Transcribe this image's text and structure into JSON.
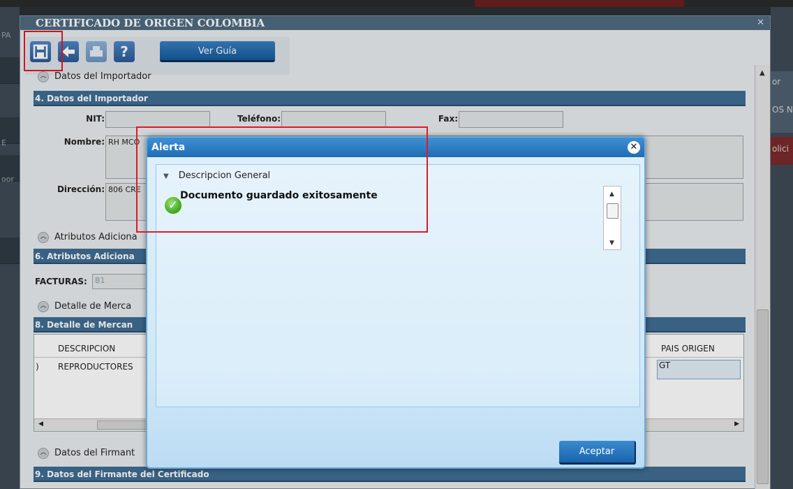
{
  "window": {
    "title": "CERTIFICADO DE ORIGEN COLOMBIA",
    "close_icon": "close-icon"
  },
  "toolbar": {
    "save_icon": "save-icon",
    "back_icon": "back-arrow-icon",
    "print_icon": "print-icon",
    "help_label": "?",
    "guide_label": "Ver Guía"
  },
  "sections": {
    "importer_toggle": "Datos del Importador",
    "importer_header": "4. Datos del Importador",
    "attrs_toggle": "Atributos Adiciona",
    "attrs_header": "6. Atributos Adiciona",
    "detail_toggle": "Detalle  de Merca",
    "detail_header": "8. Detalle de Mercan",
    "signer_toggle": "Datos del Firmant",
    "signer_header": "9. Datos del Firmante del Certificado"
  },
  "importer": {
    "nit_label": "NIT:",
    "nit_value": "",
    "phone_label": "Teléfono:",
    "phone_value": "",
    "fax_label": "Fax:",
    "fax_value": "",
    "name_label": "Nombre:",
    "name_value": "RH MCO",
    "address_label": "Dirección:",
    "address_value": "806 CRE"
  },
  "attributes": {
    "invoices_label": "FACTURAS:",
    "invoices_value": "B1"
  },
  "detail_grid": {
    "columns": [
      "DESCRIPCION",
      "PAIS ORIGEN"
    ],
    "rows": [
      {
        "index": ")",
        "description": "REPRODUCTORES",
        "origin_country": "GT"
      }
    ]
  },
  "background_ghost": {
    "left_1": "PA",
    "left_2": "E",
    "left_3": "oor",
    "right_1": "or",
    "right_2": "OS N",
    "right_3": "olici"
  },
  "dialog": {
    "title": "Alerta",
    "section_label": "Descripcion General",
    "message": "Documento guardado exitosamente",
    "ok_label": "Aceptar"
  }
}
